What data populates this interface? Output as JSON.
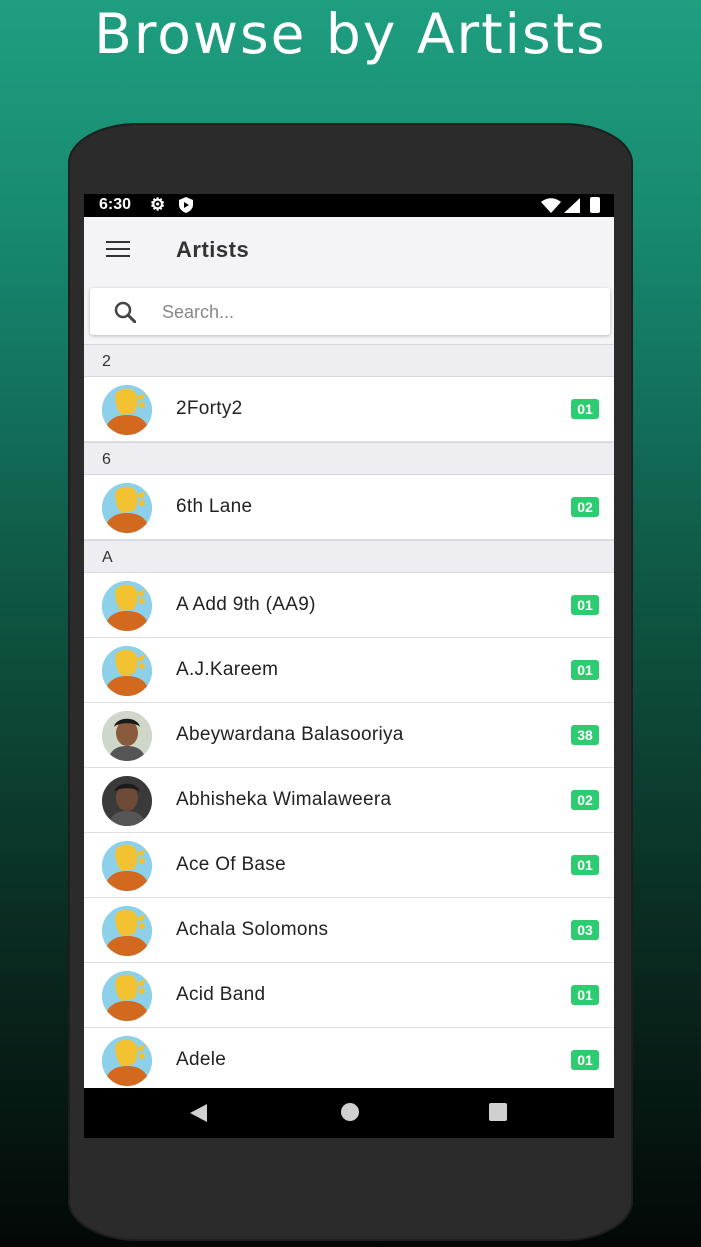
{
  "promo": {
    "title": "Browse by Artists"
  },
  "status_bar": {
    "time": "6:30"
  },
  "app_bar": {
    "title": "Artists"
  },
  "search": {
    "placeholder": "Search..."
  },
  "colors": {
    "badge": "#2ecc71",
    "background_top": "#1f9e80",
    "background_bottom": "#030806"
  },
  "sections": [
    {
      "header": "2",
      "items": [
        {
          "name": "2Forty2",
          "count": "01",
          "avatar": "default"
        }
      ]
    },
    {
      "header": "6",
      "items": [
        {
          "name": "6th Lane",
          "count": "02",
          "avatar": "default"
        }
      ]
    },
    {
      "header": "A",
      "items": [
        {
          "name": "A Add 9th (AA9)",
          "count": "01",
          "avatar": "default"
        },
        {
          "name": "A.J.Kareem",
          "count": "01",
          "avatar": "default"
        },
        {
          "name": "Abeywardana Balasooriya",
          "count": "38",
          "avatar": "photo"
        },
        {
          "name": "Abhisheka Wimalaweera",
          "count": "02",
          "avatar": "photo"
        },
        {
          "name": "Ace Of Base",
          "count": "01",
          "avatar": "default"
        },
        {
          "name": "Achala Solomons",
          "count": "03",
          "avatar": "default"
        },
        {
          "name": "Acid Band",
          "count": "01",
          "avatar": "default"
        },
        {
          "name": "Adele",
          "count": "01",
          "avatar": "default"
        }
      ]
    }
  ]
}
